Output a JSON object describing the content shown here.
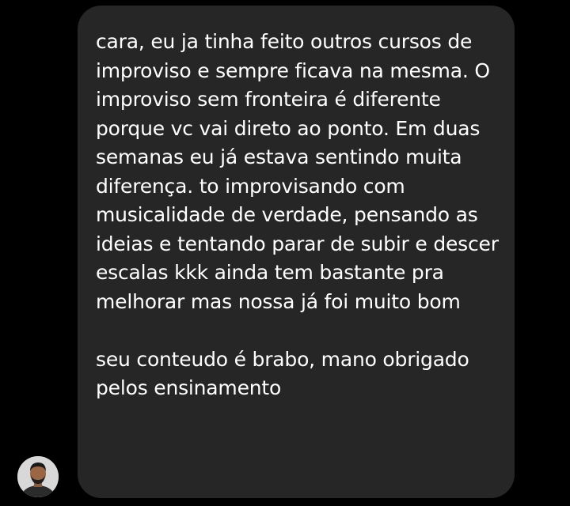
{
  "conversation": {
    "message": {
      "paragraphs": [
        "cara, eu ja tinha feito outros cursos de improviso e sempre ficava na mesma. O improviso sem fronteira é diferente porque vc vai direto ao ponto. Em duas semanas eu já estava sentindo muita diferença. to improvisando com musicalidade de verdade, pensando as ideias e tentando parar de subir e descer escalas kkk ainda tem bastante pra melhorar mas nossa já foi muito bom",
        "seu conteudo é brabo, mano obrigado pelos ensinamento"
      ]
    },
    "sender": {
      "avatar_icon": "user-avatar-photo"
    }
  },
  "colors": {
    "background": "#000000",
    "bubble": "#262626",
    "text": "#ffffff"
  }
}
